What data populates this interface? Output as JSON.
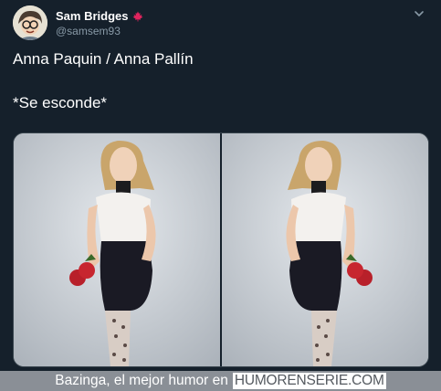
{
  "tweet": {
    "author": {
      "name": "Sam Bridges",
      "handle": "@samsem93",
      "badge_icon": "maple-leaf-icon",
      "badge_color": "#e0245e"
    },
    "menu_icon": "chevron-down-icon",
    "text_line_1": "Anna Paquin / Anna Pallín",
    "text_line_2": "*Se esconde*",
    "media": {
      "photos": [
        {
          "description_icon": "woman-photo",
          "orientation": "original"
        },
        {
          "description_icon": "woman-photo",
          "orientation": "mirrored"
        }
      ]
    }
  },
  "footer": {
    "text": "Bazinga, el mejor humor en",
    "site": "HUMORENSERIE.COM"
  },
  "colors": {
    "background": "#15202b",
    "secondary_text": "#8899a6",
    "border": "#38444d"
  }
}
